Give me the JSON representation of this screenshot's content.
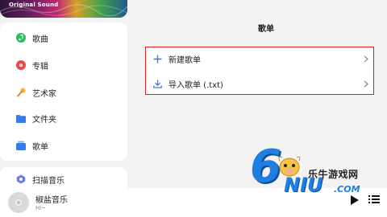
{
  "banner": {
    "caption": "Original Sound"
  },
  "nav": {
    "items": [
      {
        "label": "歌曲",
        "icon": "music-note-icon"
      },
      {
        "label": "专辑",
        "icon": "album-disc-icon"
      },
      {
        "label": "艺术家",
        "icon": "microphone-icon"
      },
      {
        "label": "文件夹",
        "icon": "folder-icon"
      },
      {
        "label": "歌单",
        "icon": "playlist-icon"
      }
    ],
    "scan_label": "扫描音乐"
  },
  "main": {
    "title": "歌单",
    "rows": [
      {
        "label": "新建歌单",
        "icon": "plus-icon"
      },
      {
        "label": "导入歌单 (.txt)",
        "icon": "download-icon"
      }
    ]
  },
  "player": {
    "title": "椒盐音乐",
    "subtitle": "Hi~"
  },
  "watermark": {
    "site_name": "乐牛游戏网",
    "digit": "6",
    "brand": "NIU",
    "suffix": ".COM"
  },
  "colors": {
    "accent": "#3a7be8",
    "highlight_border": "#e02020",
    "watermark_blue": "#1e7fe0"
  }
}
